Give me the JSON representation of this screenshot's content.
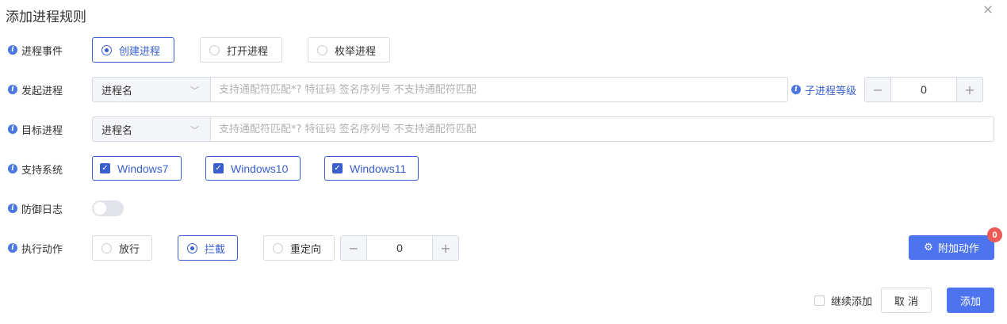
{
  "dialog": {
    "title": "添加进程规则",
    "close_icon": "×"
  },
  "process_event": {
    "label": "进程事件",
    "options": [
      "创建进程",
      "打开进程",
      "枚举进程"
    ],
    "selected": "创建进程"
  },
  "source_process": {
    "label": "发起进程",
    "select_value": "进程名",
    "placeholder": "支持通配符匹配*? 特征码 签名序列号 不支持通配符匹配",
    "child_level_label": "子进程等级",
    "child_level_value": "0",
    "minus": "−",
    "plus": "+"
  },
  "target_process": {
    "label": "目标进程",
    "select_value": "进程名",
    "placeholder": "支持通配符匹配*? 特征码 签名序列号 不支持通配符匹配"
  },
  "supported_os": {
    "label": "支持系统",
    "options": [
      "Windows7",
      "Windows10",
      "Windows11"
    ],
    "checked": [
      true,
      true,
      true
    ]
  },
  "defense_log": {
    "label": "防御日志",
    "enabled": false
  },
  "action": {
    "label": "执行动作",
    "options": [
      "放行",
      "拦截",
      "重定向"
    ],
    "selected": "拦截",
    "stepper_value": "0",
    "minus": "−",
    "plus": "+",
    "extra_button": "附加动作",
    "extra_badge": "0"
  },
  "footer": {
    "continue_label": "继续添加",
    "continue_checked": false,
    "cancel": "取 消",
    "add": "添加"
  },
  "colors": {
    "accent": "#3a5fcd",
    "primary_button": "#4d74ee",
    "badge": "#ed5b56"
  }
}
